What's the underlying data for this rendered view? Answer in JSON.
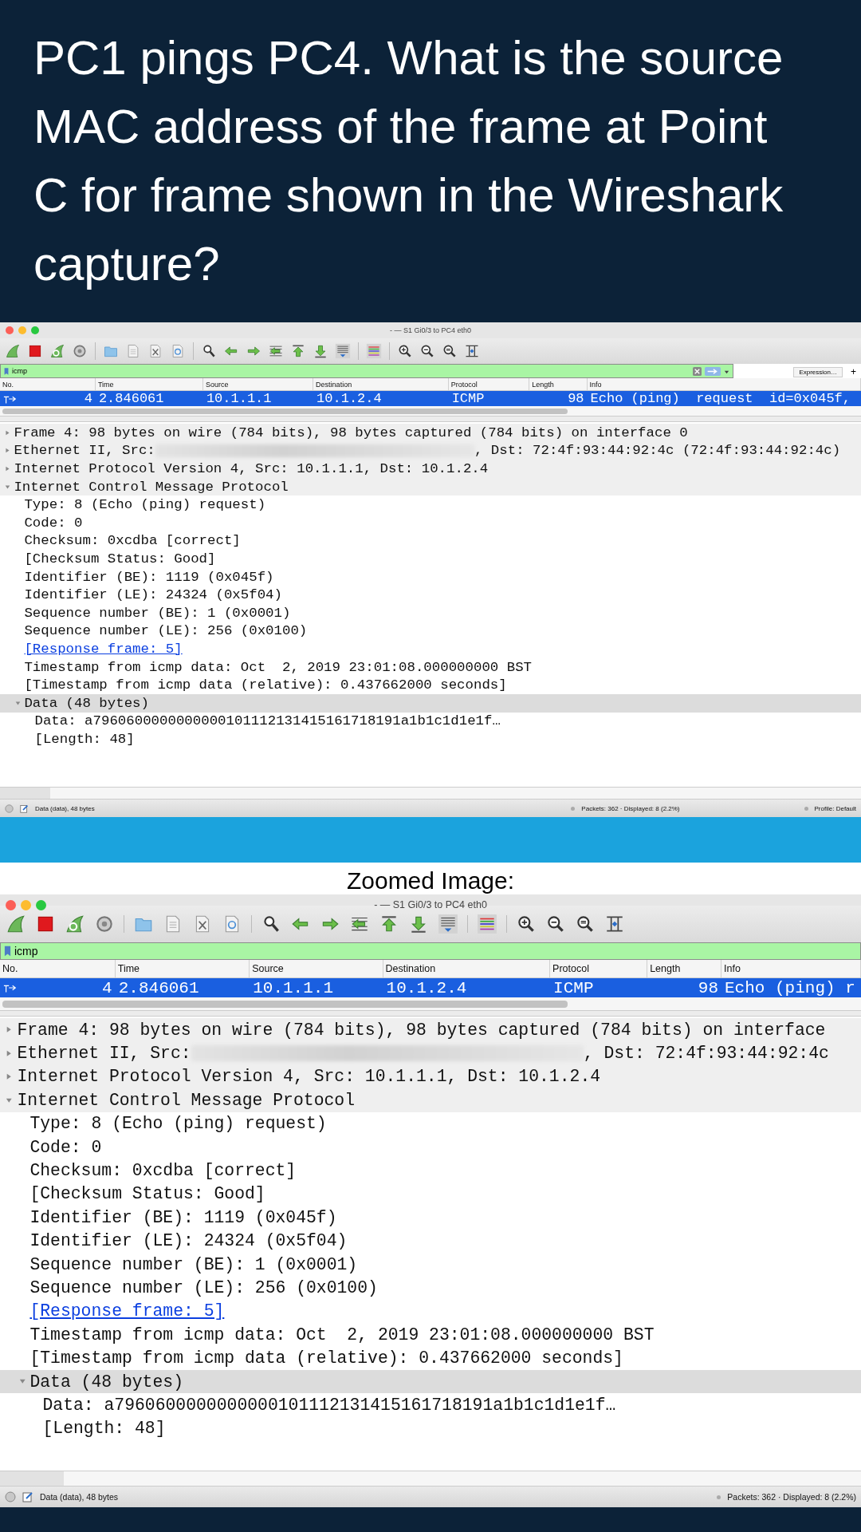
{
  "question": "PC1 pings PC4. What is the source MAC address of the frame at Point C for frame shown in the Wireshark capture?",
  "capture": {
    "window_title": "- — S1 Gi0/3 to PC4 eth0",
    "filter": {
      "value": "icmp",
      "expression_button": "Expression…",
      "add_button": "+"
    },
    "columns": [
      "No.",
      "Time",
      "Source",
      "Destination",
      "Protocol",
      "Length",
      "Info"
    ],
    "packets": [
      {
        "cells": [
          "4",
          "2.846061",
          "10.1.1.1",
          "10.1.2.4",
          "ICMP",
          "98",
          "Echo (ping)  request  id=0x045f,"
        ],
        "selected": true
      }
    ],
    "tree": [
      {
        "kind": "header",
        "text": "Frame 4: 98 bytes on wire (784 bits), 98 bytes captured (784 bits) on interface 0",
        "expanded": false,
        "selected": false
      },
      {
        "kind": "redacted",
        "text": "Ethernet II, Src:",
        "text_after": ", Dst: 72:4f:93:44:92:4c (72:4f:93:44:92:4c)",
        "expanded": false,
        "selected": false
      },
      {
        "kind": "header",
        "text": "Internet Protocol Version 4, Src: 10.1.1.1, Dst: 10.1.2.4",
        "expanded": false,
        "selected": false
      },
      {
        "kind": "header",
        "text": "Internet Control Message Protocol",
        "expanded": true,
        "selected": false,
        "children": [
          {
            "kind": "field",
            "text": "Type: 8 (Echo (ping) request)",
            "selected": false
          },
          {
            "kind": "field",
            "text": "Code: 0",
            "selected": false
          },
          {
            "kind": "field",
            "text": "Checksum: 0xcdba [correct]",
            "selected": false
          },
          {
            "kind": "field",
            "text": "[Checksum Status: Good]",
            "selected": false
          },
          {
            "kind": "field",
            "text": "Identifier (BE): 1119 (0x045f)",
            "selected": false
          },
          {
            "kind": "field",
            "text": "Identifier (LE): 24324 (0x5f04)",
            "selected": false
          },
          {
            "kind": "field",
            "text": "Sequence number (BE): 1 (0x0001)",
            "selected": false
          },
          {
            "kind": "field",
            "text": "Sequence number (LE): 256 (0x0100)",
            "selected": false
          },
          {
            "kind": "link",
            "text": "[Response frame: 5]",
            "selected": false
          },
          {
            "kind": "field",
            "text": "Timestamp from icmp data: Oct  2, 2019 23:01:08.000000000 BST",
            "selected": false
          },
          {
            "kind": "field",
            "text": "[Timestamp from icmp data (relative): 0.437662000 seconds]",
            "selected": false
          },
          {
            "kind": "header",
            "text": "Data (48 bytes)",
            "expanded": true,
            "selected": true,
            "children": [
              {
                "kind": "field",
                "text": "Data: a7960600000000000101112131415161718191a1b1c1d1e1f…",
                "selected": false
              },
              {
                "kind": "field",
                "text": "[Length: 48]",
                "selected": false
              }
            ]
          }
        ]
      }
    ],
    "status": {
      "selection": "Data (data), 48 bytes",
      "packets": "Packets: 362 · Displayed: 8 (2.2%)",
      "profile": "Profile: Default"
    }
  },
  "zoom_caption": "Zoomed Image:",
  "zoomed_capture": {
    "window_title": "- — S1 Gi0/3 to PC4 eth0",
    "filter": {
      "value": "icmp"
    },
    "columns": [
      "No.",
      "Time",
      "Source",
      "Destination",
      "Protocol",
      "Length",
      "Info"
    ],
    "packets": [
      {
        "cells": [
          "4",
          "2.846061",
          "10.1.1.1",
          "10.1.2.4",
          "ICMP",
          "98",
          "Echo (ping) r"
        ],
        "selected": true
      }
    ],
    "tree": [
      {
        "kind": "header",
        "text": "Frame 4: 98 bytes on wire (784 bits), 98 bytes captured (784 bits) on interface",
        "expanded": false,
        "selected": false
      },
      {
        "kind": "redacted",
        "text": "Ethernet II, Src:",
        "text_after": ", Dst: 72:4f:93:44:92:4c",
        "expanded": false,
        "selected": false
      },
      {
        "kind": "header",
        "text": "Internet Protocol Version 4, Src: 10.1.1.1, Dst: 10.1.2.4",
        "expanded": false,
        "selected": false
      },
      {
        "kind": "header",
        "text": "Internet Control Message Protocol",
        "expanded": true,
        "selected": false,
        "children": [
          {
            "kind": "field",
            "text": "Type: 8 (Echo (ping) request)",
            "selected": false
          },
          {
            "kind": "field",
            "text": "Code: 0",
            "selected": false
          },
          {
            "kind": "field",
            "text": "Checksum: 0xcdba [correct]",
            "selected": false
          },
          {
            "kind": "field",
            "text": "[Checksum Status: Good]",
            "selected": false
          },
          {
            "kind": "field",
            "text": "Identifier (BE): 1119 (0x045f)",
            "selected": false
          },
          {
            "kind": "field",
            "text": "Identifier (LE): 24324 (0x5f04)",
            "selected": false
          },
          {
            "kind": "field",
            "text": "Sequence number (BE): 1 (0x0001)",
            "selected": false
          },
          {
            "kind": "field",
            "text": "Sequence number (LE): 256 (0x0100)",
            "selected": false
          },
          {
            "kind": "link",
            "text": "[Response frame: 5]",
            "selected": false
          },
          {
            "kind": "field",
            "text": "Timestamp from icmp data: Oct  2, 2019 23:01:08.000000000 BST",
            "selected": false
          },
          {
            "kind": "field",
            "text": "[Timestamp from icmp data (relative): 0.437662000 seconds]",
            "selected": false
          },
          {
            "kind": "header",
            "text": "Data (48 bytes)",
            "expanded": true,
            "selected": true,
            "children": [
              {
                "kind": "field",
                "text": "Data: a7960600000000000101112131415161718191a1b1c1d1e1f…",
                "selected": false
              },
              {
                "kind": "field",
                "text": "[Length: 48]",
                "selected": false
              }
            ]
          }
        ]
      }
    ],
    "status": {
      "selection": "Data (data), 48 bytes",
      "packets": "Packets: 362 · Displayed: 8 (2.2%)"
    }
  }
}
